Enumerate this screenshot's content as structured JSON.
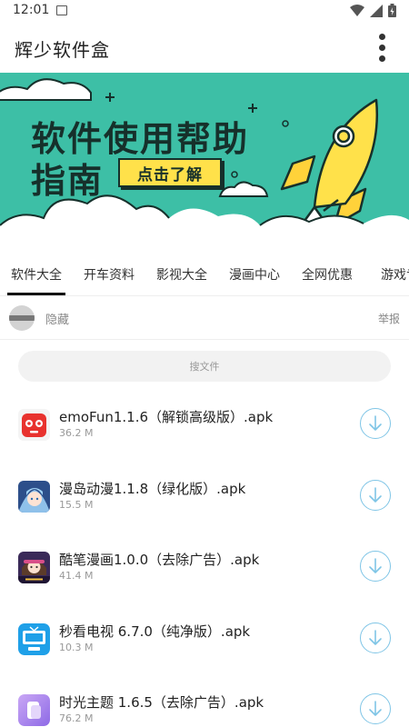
{
  "status_bar": {
    "time": "12:01"
  },
  "app_bar": {
    "title": "辉少软件盒"
  },
  "banner": {
    "title_line1": "软件使用帮助",
    "title_line2": "指南",
    "cta": "点击了解",
    "colors": {
      "background": "#3dbfa6",
      "cta": "#ffe14a",
      "ink": "#16302b"
    }
  },
  "tabs": [
    {
      "label": "软件大全",
      "active": true
    },
    {
      "label": "开车资料",
      "active": false
    },
    {
      "label": "影视大全",
      "active": false
    },
    {
      "label": "漫画中心",
      "active": false
    },
    {
      "label": "全网优惠",
      "active": false
    },
    {
      "label": "游戏专",
      "active": false
    }
  ],
  "hide_row": {
    "label": "隐藏",
    "report": "举报"
  },
  "search": {
    "placeholder": "搜文件",
    "value": ""
  },
  "files": [
    {
      "name": "emoFun1.1.6（解锁高级版）.apk",
      "size": "36.2 M",
      "icon": "emofun-app-icon"
    },
    {
      "name": "漫岛动漫1.1.8（绿化版）.apk",
      "size": "15.5 M",
      "icon": "mandao-app-icon"
    },
    {
      "name": "酷笔漫画1.0.0（去除广告）.apk",
      "size": "41.4 M",
      "icon": "kubi-manhua-app-icon"
    },
    {
      "name": "秒看电视 6.7.0（纯净版）.apk",
      "size": "10.3 M",
      "icon": "miaokan-tv-app-icon"
    },
    {
      "name": "时光主题 1.6.5（去除广告）.apk",
      "size": "76.2 M",
      "icon": "shiguang-theme-app-icon"
    }
  ],
  "accent_colors": {
    "download": "#7fc5e6",
    "tab_indicator": "#111111"
  }
}
